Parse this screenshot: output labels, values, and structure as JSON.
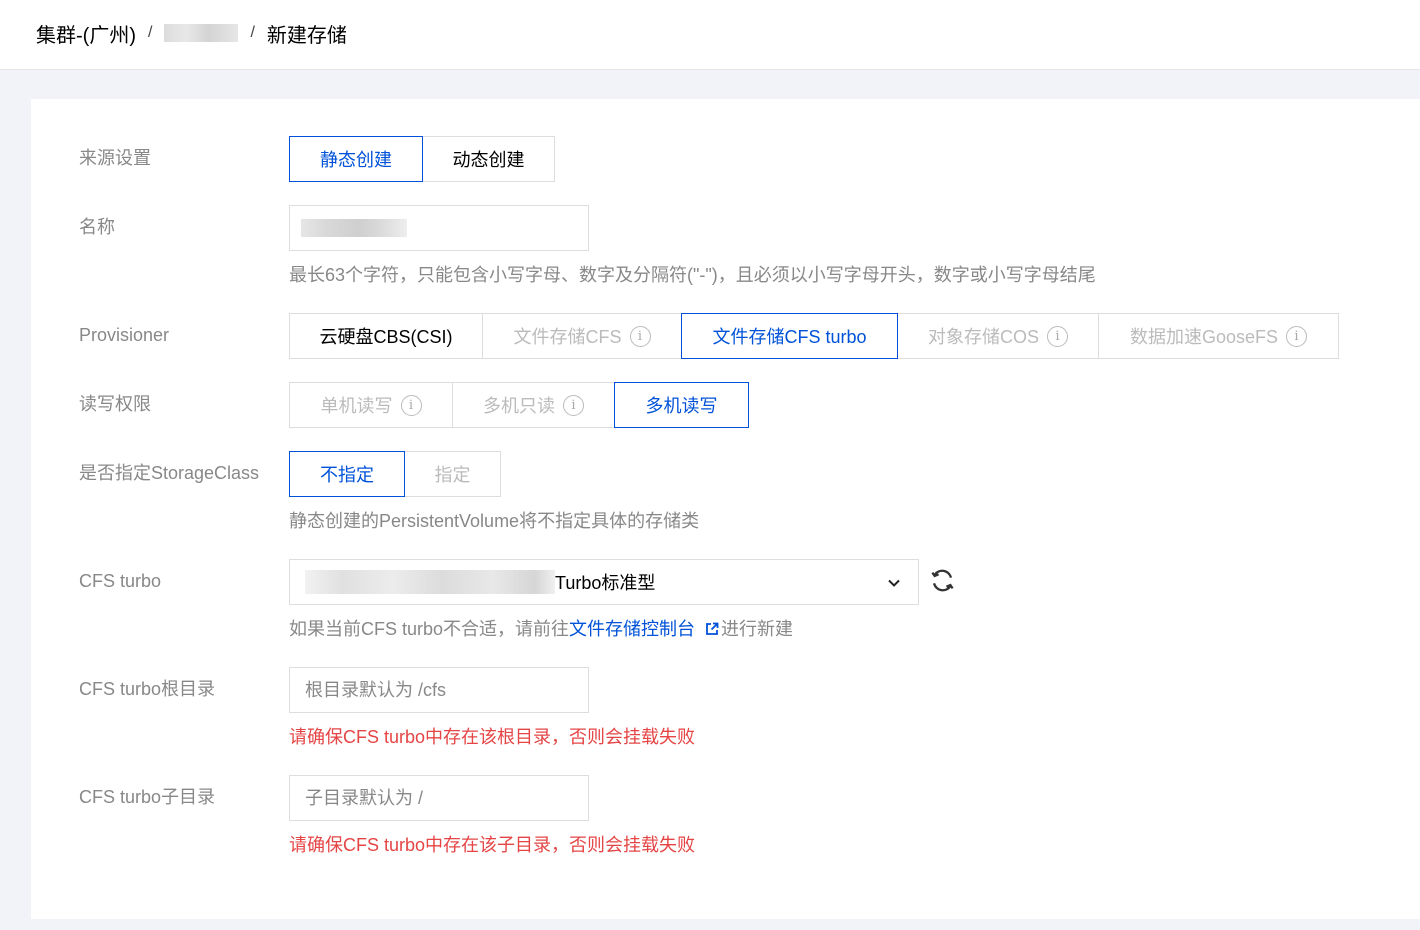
{
  "breadcrumb": {
    "cluster": "集群-(广州)",
    "separator": "/",
    "current": "新建存储"
  },
  "form": {
    "source": {
      "label": "来源设置",
      "options": [
        "静态创建",
        "动态创建"
      ],
      "selected": "静态创建"
    },
    "name": {
      "label": "名称",
      "hint": "最长63个字符，只能包含小写字母、数字及分隔符(\"-\")，且必须以小写字母开头，数字或小写字母结尾"
    },
    "provisioner": {
      "label": "Provisioner",
      "options": [
        "云硬盘CBS(CSI)",
        "文件存储CFS",
        "文件存储CFS turbo",
        "对象存储COS",
        "数据加速GooseFS"
      ],
      "selected": "文件存储CFS turbo",
      "disabled": [
        "文件存储CFS",
        "对象存储COS",
        "数据加速GooseFS"
      ]
    },
    "access": {
      "label": "读写权限",
      "options": [
        "单机读写",
        "多机只读",
        "多机读写"
      ],
      "selected": "多机读写",
      "disabled": [
        "单机读写",
        "多机只读"
      ]
    },
    "storage_class": {
      "label": "是否指定StorageClass",
      "options": [
        "不指定",
        "指定"
      ],
      "selected": "不指定",
      "hint": "静态创建的PersistentVolume将不指定具体的存储类"
    },
    "cfs_turbo": {
      "label": "CFS turbo",
      "selected_suffix": "Turbo标准型",
      "hint_before": "如果当前CFS turbo不合适，请前往",
      "hint_link": "文件存储控制台",
      "hint_after": "进行新建"
    },
    "root_dir": {
      "label": "CFS turbo根目录",
      "placeholder": "根目录默认为 /cfs",
      "error": "请确保CFS turbo中存在该根目录，否则会挂载失败"
    },
    "sub_dir": {
      "label": "CFS turbo子目录",
      "placeholder": "子目录默认为 /",
      "error": "请确保CFS turbo中存在该子目录，否则会挂载失败"
    }
  },
  "colors": {
    "accent": "#0052d9",
    "error": "#e54545",
    "label": "#888888",
    "border": "#dddddd"
  }
}
